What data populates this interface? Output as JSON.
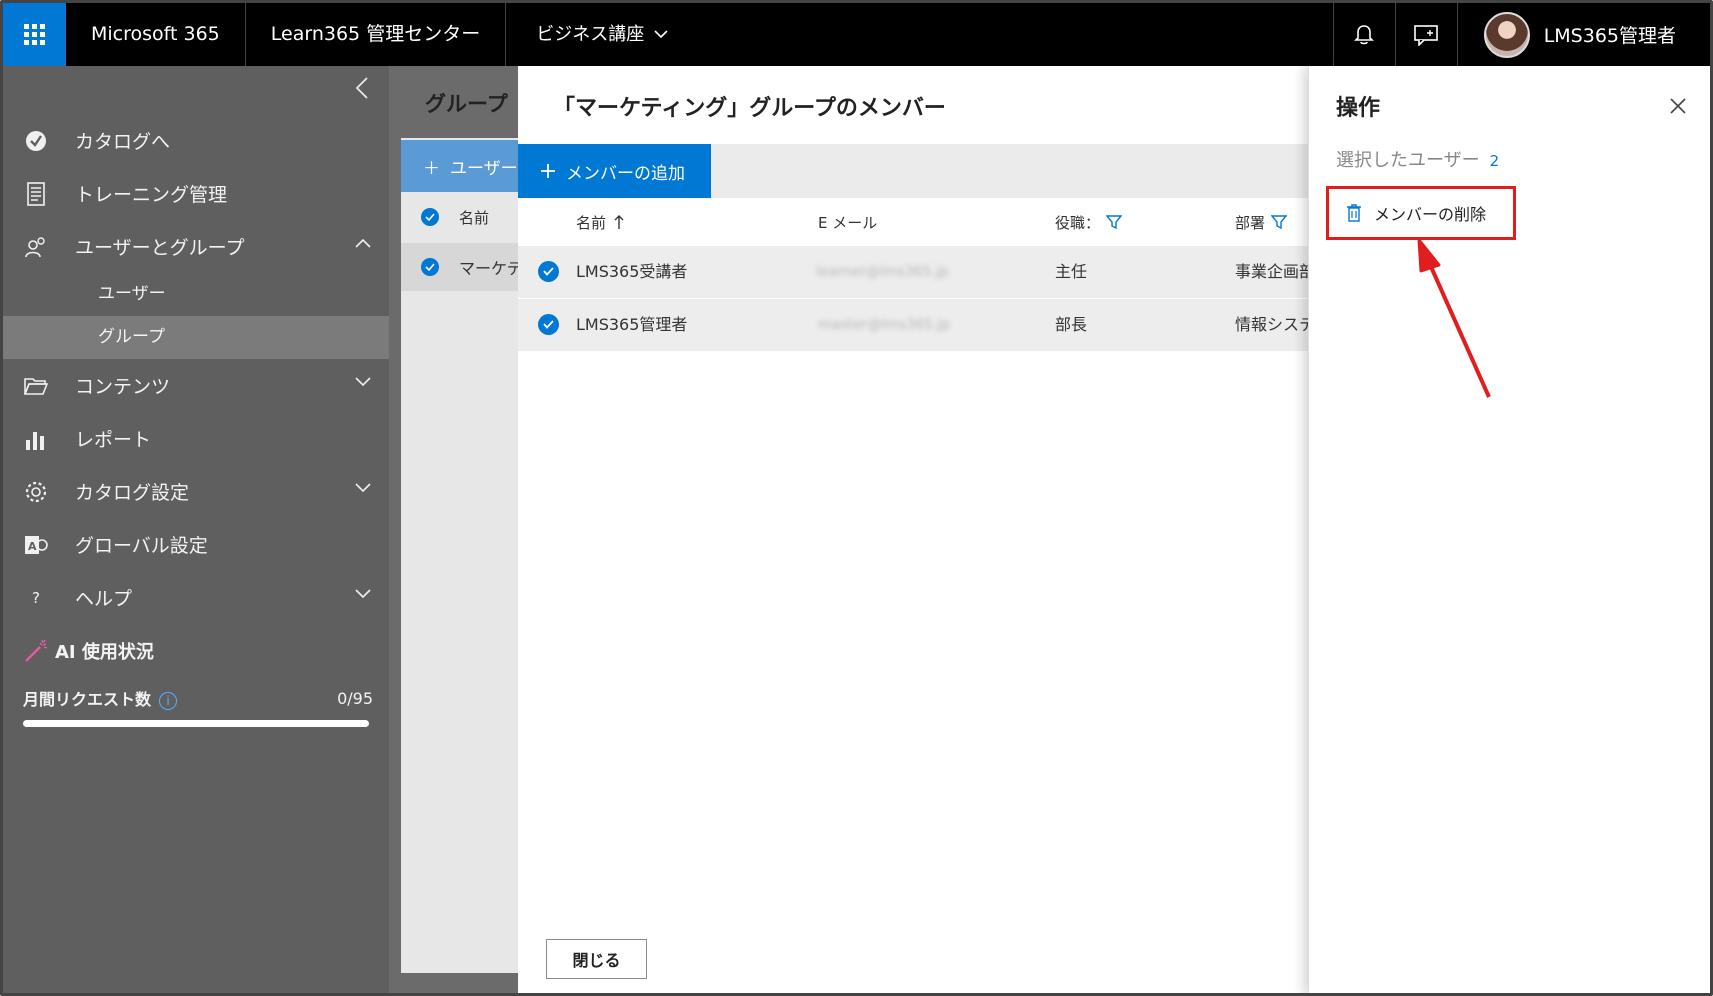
{
  "topbar": {
    "brand": "Microsoft 365",
    "app_title": "Learn365 管理センター",
    "course": "ビジネス講座",
    "user_name": "LMS365管理者"
  },
  "sidebar": {
    "items": [
      {
        "label": "カタログへ",
        "icon": "catalog-icon"
      },
      {
        "label": "トレーニング管理",
        "icon": "training-icon"
      },
      {
        "label": "ユーザーとグループ",
        "icon": "users-icon"
      },
      {
        "label": "コンテンツ",
        "icon": "folder-icon"
      },
      {
        "label": "レポート",
        "icon": "chart-icon"
      },
      {
        "label": "カタログ設定",
        "icon": "gear-icon"
      },
      {
        "label": "グローバル設定",
        "icon": "global-settings-icon"
      },
      {
        "label": "ヘルプ",
        "icon": "help-icon"
      }
    ],
    "sub_items": [
      {
        "label": "ユーザー"
      },
      {
        "label": "グループ"
      }
    ],
    "ai": {
      "title": "AI 使用状況",
      "request_label": "月間リクエスト数",
      "request_count": "0/95",
      "usage_fraction": 0
    }
  },
  "background": {
    "title": "グループ",
    "add_label": "ユーザー",
    "col_name": "名前",
    "row_name": "マーケテ"
  },
  "panel": {
    "title": "「マーケティング」グループのメンバー",
    "add_member": "メンバーの追加",
    "columns": {
      "name": "名前",
      "email": "E メール",
      "role": "役職：",
      "dept": "部署"
    },
    "rows": [
      {
        "name": "LMS365受講者",
        "email": "learner@lms365.jp",
        "role": "主任",
        "dept": "事業企画部"
      },
      {
        "name": "LMS365管理者",
        "email": "master@lms365.jp",
        "role": "部長",
        "dept": "情報システム"
      }
    ],
    "close_label": "閉じる"
  },
  "action": {
    "title": "操作",
    "selected_label": "選択したユーザー",
    "selected_count": "2",
    "remove_label": "メンバーの削除"
  },
  "colors": {
    "accent": "#0078d4",
    "highlight": "#e01e1e",
    "sidebar_bg": "#5f5f5f"
  }
}
